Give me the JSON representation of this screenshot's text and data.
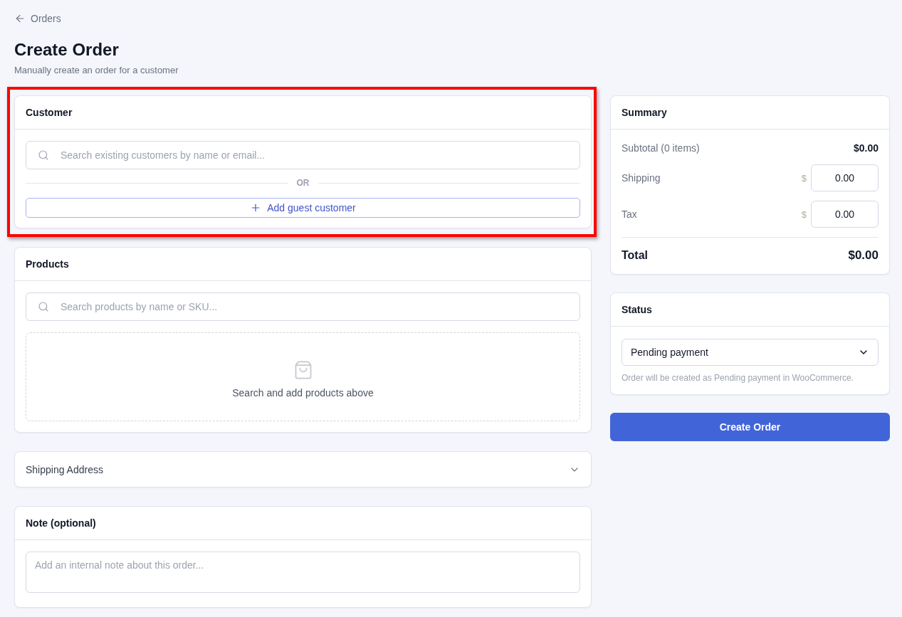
{
  "back_link": {
    "label": "Orders"
  },
  "page": {
    "title": "Create Order",
    "subtitle": "Manually create an order for a customer"
  },
  "customer": {
    "title": "Customer",
    "highlighted": true,
    "search": {
      "placeholder": "Search existing customers by name or email..."
    },
    "divider_label": "OR",
    "add_guest_button": "Add guest customer"
  },
  "products": {
    "title": "Products",
    "search": {
      "placeholder": "Search products by name or SKU..."
    },
    "empty_state": "Search and add products above"
  },
  "shipping_address": {
    "title": "Shipping Address",
    "expanded": false
  },
  "note": {
    "title": "Note (optional)",
    "placeholder": "Add an internal note about this order..."
  },
  "summary": {
    "title": "Summary",
    "rows": [
      {
        "kind": "text",
        "label": "Subtotal (0 items)",
        "value": "$0.00"
      },
      {
        "kind": "input",
        "label": "Shipping",
        "currency": "$",
        "value": "0.00"
      },
      {
        "kind": "input",
        "label": "Tax",
        "currency": "$",
        "value": "0.00"
      }
    ],
    "total": {
      "label": "Total",
      "value": "$0.00"
    }
  },
  "status": {
    "title": "Status",
    "select": {
      "value": "Pending payment"
    },
    "hint": "Order will be created as Pending payment in WooCommerce."
  },
  "submit_button": "Create Order"
}
